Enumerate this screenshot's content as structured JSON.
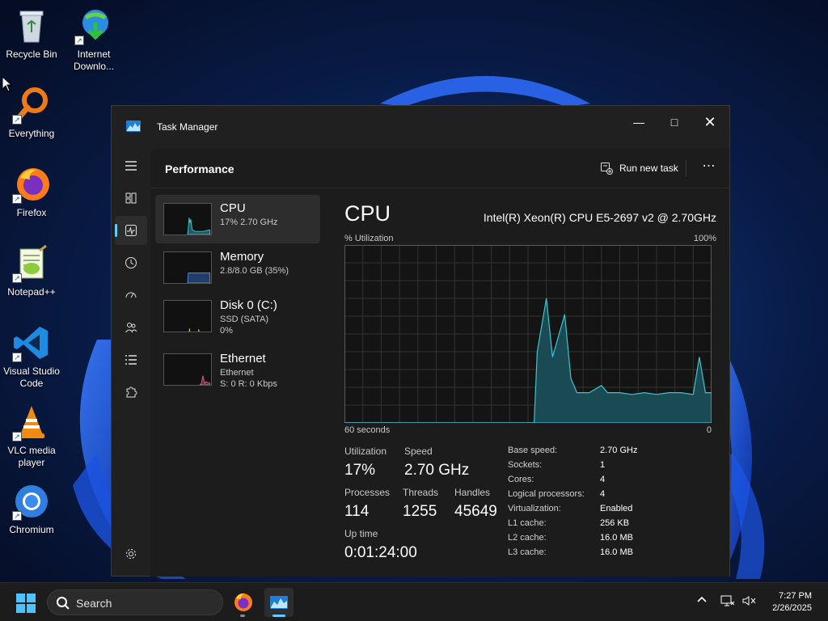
{
  "desktop": {
    "icons": [
      {
        "label": "Recycle Bin",
        "icon": "recycle-bin-icon"
      },
      {
        "label": "Internet Downlo...",
        "icon": "internet-download-manager-icon"
      },
      {
        "label": "Everything",
        "icon": "everything-search-icon"
      },
      {
        "label": "Firefox",
        "icon": "firefox-icon"
      },
      {
        "label": "Notepad++",
        "icon": "notepad-plus-plus-icon"
      },
      {
        "label": "Visual Studio Code",
        "icon": "vscode-icon"
      },
      {
        "label": "VLC media player",
        "icon": "vlc-icon"
      },
      {
        "label": "Chromium",
        "icon": "chromium-icon"
      }
    ]
  },
  "window": {
    "title": "Task Manager",
    "page_title": "Performance",
    "run_new_task": "Run new task",
    "more": "⋯"
  },
  "resources": [
    {
      "name": "CPU",
      "sub1": "17% 2.70 GHz",
      "sub2": "",
      "color": "#3ec3d0"
    },
    {
      "name": "Memory",
      "sub1": "2.8/8.0 GB (35%)",
      "sub2": "",
      "color": "#4a8fe0"
    },
    {
      "name": "Disk 0 (C:)",
      "sub1": "SSD (SATA)",
      "sub2": "0%",
      "color": "#8fc04a"
    },
    {
      "name": "Ethernet",
      "sub1": "Ethernet",
      "sub2": "S: 0 R: 0 Kbps",
      "color": "#d0608a"
    }
  ],
  "cpu": {
    "title": "CPU",
    "model": "Intel(R) Xeon(R) CPU E5-2697 v2 @ 2.70GHz",
    "util_label": "% Utilization",
    "util_max": "100%",
    "time_left": "60 seconds",
    "time_right": "0",
    "stats": {
      "utilization_label": "Utilization",
      "utilization": "17%",
      "speed_label": "Speed",
      "speed": "2.70 GHz",
      "processes_label": "Processes",
      "processes": "114",
      "threads_label": "Threads",
      "threads": "1255",
      "handles_label": "Handles",
      "handles": "45649",
      "uptime_label": "Up time",
      "uptime": "0:01:24:00"
    },
    "specs": [
      {
        "key": "Base speed:",
        "value": "2.70 GHz"
      },
      {
        "key": "Sockets:",
        "value": "1"
      },
      {
        "key": "Cores:",
        "value": "4"
      },
      {
        "key": "Logical processors:",
        "value": "4"
      },
      {
        "key": "Virtualization:",
        "value": "Enabled"
      },
      {
        "key": "L1 cache:",
        "value": "256 KB"
      },
      {
        "key": "L2 cache:",
        "value": "16.0 MB"
      },
      {
        "key": "L3 cache:",
        "value": "16.0 MB"
      }
    ]
  },
  "chart_data": {
    "type": "area",
    "title": "% Utilization",
    "ylim": [
      0,
      100
    ],
    "x_range_seconds": [
      60,
      0
    ],
    "x": [
      60,
      29,
      28.5,
      27,
      26,
      24,
      23,
      22,
      20,
      18,
      17,
      15,
      13,
      11,
      9,
      7,
      5,
      3,
      2,
      1,
      0
    ],
    "values": [
      0,
      0,
      40,
      70,
      37,
      61,
      25,
      17,
      17,
      21,
      17,
      17,
      16,
      17,
      16,
      17,
      17,
      16,
      37,
      17,
      17
    ],
    "color": "#3ec3d0",
    "grid": true
  },
  "taskbar": {
    "search_placeholder": "Search",
    "time": "7:27 PM",
    "date": "2/26/2025"
  },
  "colors": {
    "accent": "#60cdff",
    "window_bg": "#202020",
    "content_bg": "#1c1c1c"
  }
}
